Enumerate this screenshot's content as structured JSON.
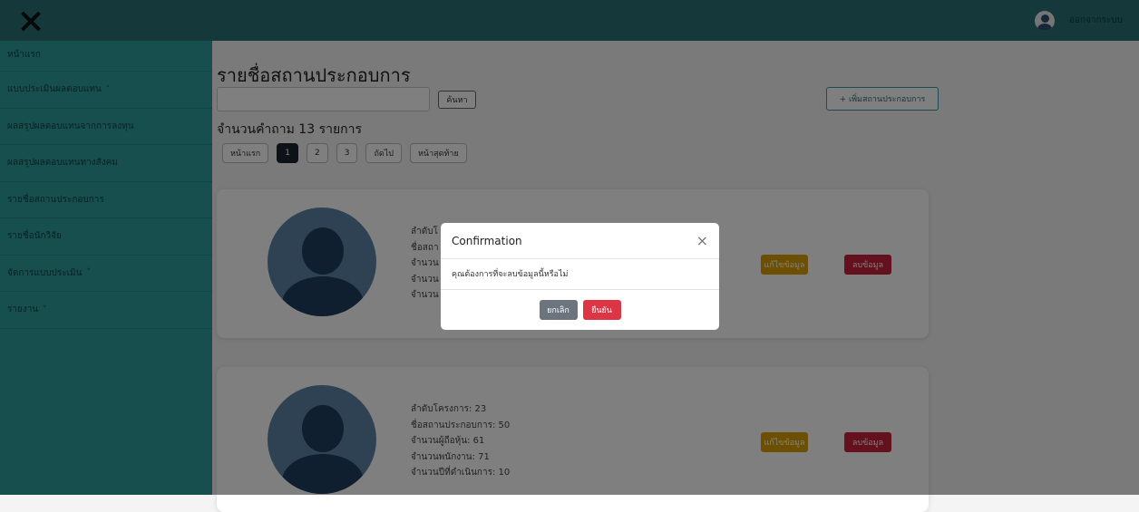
{
  "topbar": {
    "close_icon": "close-x-icon",
    "avatar_icon": "user-avatar-icon",
    "logout_label": "ออกจากระบบ"
  },
  "sidebar": {
    "items": [
      {
        "label": "หน้าแรก",
        "has_chevron": false
      },
      {
        "label": "แบบประเมินผลตอบแทน",
        "has_chevron": true
      },
      {
        "label": "ผลสรุปผลตอบแทนจากการลงทุน",
        "has_chevron": false
      },
      {
        "label": "ผลสรุปผลตอบแทนทางสังคม",
        "has_chevron": false
      },
      {
        "label": "รายชื่อสถานประกอบการ",
        "has_chevron": false
      },
      {
        "label": "รายชื่อนักวิจัย",
        "has_chevron": false
      },
      {
        "label": "จัดการแบบประเมิน",
        "has_chevron": true
      },
      {
        "label": "รายงาน",
        "has_chevron": true
      }
    ],
    "chevron": "˅"
  },
  "main": {
    "title": "รายชื่อสถานประกอบการ",
    "search_placeholder": "",
    "search_button": "ค้นหา",
    "add_button": "+ เพิ่มสถานประกอบการ",
    "count_text": "จำนวนคำถาม 13 รายการ",
    "pager": [
      "หน้าแรก",
      "1",
      "2",
      "3",
      "ถัดไป",
      "หน้าสุดท้าย"
    ],
    "pager_active_index": 1
  },
  "cards": [
    {
      "lines": [
        "ลำดับโ",
        "ชื่อสถา",
        "จำนวน",
        "จำนวน",
        "จำนวน"
      ],
      "edit_label": "แก้ไขข้อมูล",
      "delete_label": "ลบข้อมูล"
    },
    {
      "lines": [
        "ลำดับโครงการ: 23",
        "ชื่อสถานประกอบการ: 50",
        "จำนวนผู้ถือหุ้น: 61",
        "จำนวนพนักงาน: 71",
        "จำนวนปีที่ดำเนินการ: 10"
      ],
      "edit_label": "แก้ไขข้อมูล",
      "delete_label": "ลบข้อมูล"
    }
  ],
  "modal": {
    "title": "Confirmation",
    "close_glyph": "×",
    "message": "คุณต้องการที่จะลบข้อมูลนี้หรือไม่",
    "cancel_label": "ยกเลิก",
    "confirm_label": "ยืนยัน"
  },
  "colors": {
    "topbar": "#2a7377",
    "sidebar": "#2f9c9c",
    "edit": "#d99f00",
    "delete": "#c8203a",
    "confirm": "#dc3545",
    "cancel": "#6c757d"
  }
}
